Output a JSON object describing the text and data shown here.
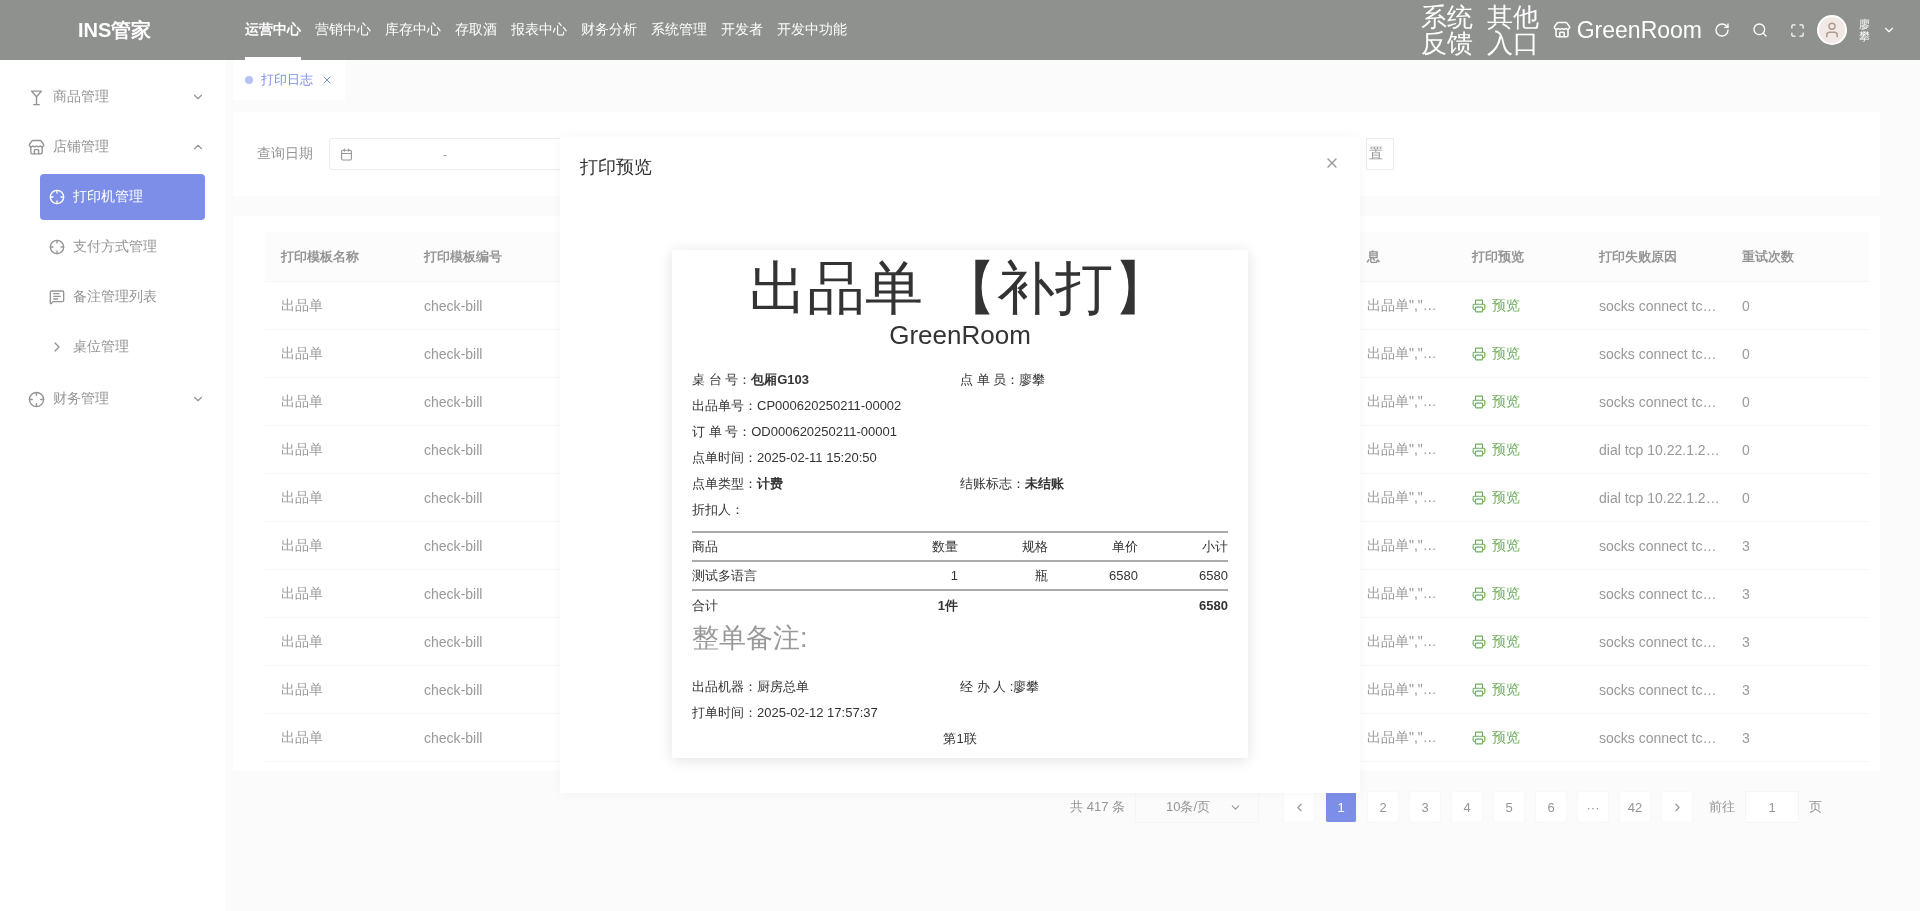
{
  "topbar": {
    "logo": "INS管家",
    "nav": [
      {
        "label": "运营中心",
        "selected": true
      },
      {
        "label": "营销中心",
        "selected": false
      },
      {
        "label": "库存中心",
        "selected": false
      },
      {
        "label": "存取酒",
        "selected": false
      },
      {
        "label": "报表中心",
        "selected": false
      },
      {
        "label": "财务分析",
        "selected": false
      },
      {
        "label": "系统管理",
        "selected": false
      },
      {
        "label": "开发者",
        "selected": false
      },
      {
        "label": "开发中功能",
        "selected": false
      }
    ],
    "links": [
      "系统反馈",
      "其他入口"
    ],
    "store": "GreenRoom",
    "user": "廖攀"
  },
  "sidebar": {
    "items": [
      {
        "label": "商品管理",
        "expanded": false
      },
      {
        "label": "店铺管理",
        "expanded": true,
        "children": [
          {
            "label": "打印机管理",
            "selected": true
          },
          {
            "label": "支付方式管理",
            "selected": false
          },
          {
            "label": "备注管理列表",
            "selected": false
          },
          {
            "label": "桌位管理",
            "selected": false
          }
        ]
      },
      {
        "label": "财务管理",
        "expanded": false
      }
    ]
  },
  "tabs": [
    {
      "label": "打印日志",
      "selected": true
    }
  ],
  "filter": {
    "label": "查询日期",
    "range_separator": "-",
    "button": "置"
  },
  "table": {
    "columns": [
      "打印模板名称",
      "打印模板编号",
      "息",
      "打印预览",
      "打印失败原因",
      "重试次数"
    ],
    "rows": [
      [
        "出品单",
        "check-bill",
        "出品单\",\"…",
        "预览",
        "socks connect tc…",
        "0"
      ],
      [
        "出品单",
        "check-bill",
        "出品单\",\"…",
        "预览",
        "socks connect tc…",
        "0"
      ],
      [
        "出品单",
        "check-bill",
        "出品单\",\"…",
        "预览",
        "socks connect tc…",
        "0"
      ],
      [
        "出品单",
        "check-bill",
        "出品单\",\"…",
        "预览",
        "dial tcp 10.22.1.2…",
        "0"
      ],
      [
        "出品单",
        "check-bill",
        "出品单\",\"…",
        "预览",
        "dial tcp 10.22.1.2…",
        "0"
      ],
      [
        "出品单",
        "check-bill",
        "出品单\",\"…",
        "预览",
        "socks connect tc…",
        "3"
      ],
      [
        "出品单",
        "check-bill",
        "出品单\",\"…",
        "预览",
        "socks connect tc…",
        "3"
      ],
      [
        "出品单",
        "check-bill",
        "出品单\",\"…",
        "预览",
        "socks connect tc…",
        "3"
      ],
      [
        "出品单",
        "check-bill",
        "出品单\",\"…",
        "预览",
        "socks connect tc…",
        "3"
      ],
      [
        "出品单",
        "check-bill",
        "出品单\",\"…",
        "预览",
        "socks connect tc…",
        "3"
      ]
    ]
  },
  "pagination": {
    "total": "共 417 条",
    "page_size": "10条/页",
    "pages": [
      {
        "label": "1",
        "selected": true
      },
      {
        "label": "2",
        "selected": false
      },
      {
        "label": "3",
        "selected": false
      },
      {
        "label": "4",
        "selected": false
      },
      {
        "label": "5",
        "selected": false
      },
      {
        "label": "6",
        "selected": false
      },
      {
        "label": "···",
        "selected": false
      },
      {
        "label": "42",
        "selected": false
      }
    ],
    "goto_label": "前往",
    "goto_value": "1",
    "goto_suffix": "页"
  },
  "modal": {
    "title": "打印预览",
    "receipt": {
      "title": "出品单 【补打】",
      "store": "GreenRoom",
      "info_rows": [
        [
          "桌 台 号：**包厢G103**",
          "点 单 员：廖攀"
        ],
        [
          "出品单号：CP000620250211-00002"
        ],
        [
          "订 单 号：OD000620250211-00001"
        ],
        [
          "点单时间：2025-02-11 15:20:50"
        ],
        [
          "点单类型：**计费**",
          "结账标志：**未结账**"
        ],
        [
          "折扣人："
        ]
      ],
      "columns": [
        "商品",
        "数量",
        "规格",
        "单价",
        "小计"
      ],
      "items": [
        [
          "测试多语言",
          "1",
          "瓶",
          "6580",
          "6580"
        ]
      ],
      "total": {
        "label": "合计",
        "quantity": "1件",
        "amount": "6580"
      },
      "remark": "整单备注:",
      "footer_rows": [
        [
          "出品机器：厨房总单",
          "经 办 人 :廖攀"
        ],
        [
          "打单时间：2025-02-12 17:57:37"
        ]
      ],
      "copy": "第1联"
    }
  }
}
